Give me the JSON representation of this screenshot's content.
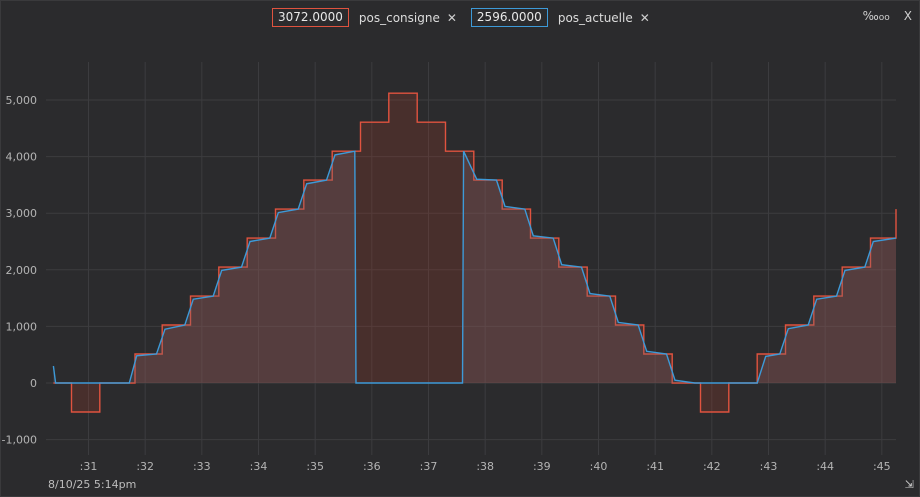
{
  "header": {
    "series": [
      {
        "value_label": "3072.0000",
        "name": "pos_consigne",
        "color": "#e0533f"
      },
      {
        "value_label": "2596.0000",
        "name": "pos_actuelle",
        "color": "#3d9ad8"
      }
    ],
    "close_glyph": "✕",
    "scale_icon_label": "‰",
    "close_panel_glyph": "X"
  },
  "footer": {
    "timestamp": "8/10/25 5:14pm",
    "resize_glyph": "⇲"
  },
  "chart_data": {
    "type": "line",
    "xlabel": "",
    "ylabel": "",
    "ylim": [
      -1000,
      5000
    ],
    "xlim": [
      30.25,
      45.25
    ],
    "y_ticks": [
      -1000,
      0,
      1000,
      2000,
      3000,
      4000,
      5000
    ],
    "y_tick_labels": [
      "-1,000",
      "0",
      "1,000",
      "2,000",
      "3,000",
      "4,000",
      "5,000"
    ],
    "x_ticks": [
      31,
      32,
      33,
      34,
      35,
      36,
      37,
      38,
      39,
      40,
      41,
      42,
      43,
      44,
      45
    ],
    "x_tick_labels": [
      ":31",
      ":32",
      ":33",
      ":34",
      ":35",
      ":36",
      ":37",
      ":38",
      ":39",
      ":40",
      ":41",
      ":42",
      ":43",
      ":44",
      ":45"
    ],
    "grid": true,
    "series": [
      {
        "name": "pos_consigne",
        "color": "#e0533f",
        "fill": "rgba(160,60,45,0.25)",
        "step": true,
        "points": [
          [
            30.38,
            0
          ],
          [
            30.7,
            -512
          ],
          [
            31.2,
            0
          ],
          [
            31.82,
            512
          ],
          [
            32.3,
            1024
          ],
          [
            32.8,
            1536
          ],
          [
            33.3,
            2048
          ],
          [
            33.8,
            2560
          ],
          [
            34.3,
            3072
          ],
          [
            34.8,
            3584
          ],
          [
            35.3,
            4096
          ],
          [
            35.8,
            4608
          ],
          [
            36.3,
            5120
          ],
          [
            36.8,
            4608
          ],
          [
            37.3,
            4096
          ],
          [
            37.8,
            3584
          ],
          [
            38.3,
            3072
          ],
          [
            38.8,
            2560
          ],
          [
            39.3,
            2048
          ],
          [
            39.8,
            1536
          ],
          [
            40.3,
            1024
          ],
          [
            40.8,
            512
          ],
          [
            41.3,
            0
          ],
          [
            41.8,
            -512
          ],
          [
            42.3,
            0
          ],
          [
            42.8,
            512
          ],
          [
            43.3,
            1024
          ],
          [
            43.8,
            1536
          ],
          [
            44.3,
            2048
          ],
          [
            44.8,
            2560
          ],
          [
            45.25,
            3072
          ]
        ],
        "end_x": 45.25
      },
      {
        "name": "pos_actuelle",
        "color": "#3d9ad8",
        "fill": "rgba(120,100,110,0.28)",
        "step": false,
        "points": [
          [
            30.38,
            300
          ],
          [
            30.42,
            0
          ],
          [
            31.55,
            0
          ],
          [
            31.72,
            0
          ],
          [
            31.85,
            480
          ],
          [
            32.2,
            512
          ],
          [
            32.35,
            950
          ],
          [
            32.7,
            1024
          ],
          [
            32.85,
            1480
          ],
          [
            33.2,
            1536
          ],
          [
            33.35,
            1990
          ],
          [
            33.7,
            2048
          ],
          [
            33.85,
            2500
          ],
          [
            34.2,
            2560
          ],
          [
            34.35,
            3010
          ],
          [
            34.7,
            3072
          ],
          [
            34.85,
            3520
          ],
          [
            35.2,
            3584
          ],
          [
            35.35,
            4030
          ],
          [
            35.7,
            4096
          ],
          [
            35.72,
            0
          ],
          [
            37.6,
            0
          ],
          [
            37.62,
            4096
          ],
          [
            37.85,
            3600
          ],
          [
            38.2,
            3584
          ],
          [
            38.35,
            3120
          ],
          [
            38.7,
            3072
          ],
          [
            38.85,
            2600
          ],
          [
            39.2,
            2560
          ],
          [
            39.35,
            2090
          ],
          [
            39.7,
            2048
          ],
          [
            39.85,
            1580
          ],
          [
            40.2,
            1536
          ],
          [
            40.35,
            1070
          ],
          [
            40.7,
            1024
          ],
          [
            40.85,
            560
          ],
          [
            41.2,
            512
          ],
          [
            41.35,
            50
          ],
          [
            41.7,
            0
          ],
          [
            42.8,
            0
          ],
          [
            42.95,
            470
          ],
          [
            43.2,
            512
          ],
          [
            43.35,
            960
          ],
          [
            43.7,
            1024
          ],
          [
            43.85,
            1480
          ],
          [
            44.2,
            1536
          ],
          [
            44.35,
            1990
          ],
          [
            44.7,
            2048
          ],
          [
            44.85,
            2500
          ],
          [
            45.25,
            2560
          ]
        ]
      }
    ]
  }
}
